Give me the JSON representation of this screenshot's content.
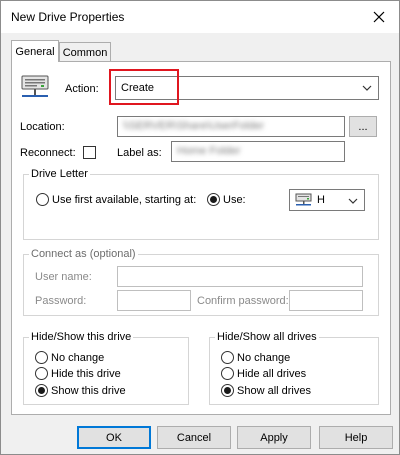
{
  "window": {
    "title": "New Drive Properties"
  },
  "tabs": [
    {
      "label": "General",
      "active": true
    },
    {
      "label": "Common",
      "active": false
    }
  ],
  "action": {
    "label": "Action:",
    "value": "Create",
    "icon": "network-drive-icon"
  },
  "location": {
    "label": "Location:",
    "value": "\\\\SERVER\\Share\\UserFolder",
    "browse_label": "..."
  },
  "reconnect": {
    "label": "Reconnect:",
    "checked": false
  },
  "label_as": {
    "label": "Label as:",
    "value": "Home Folder"
  },
  "drive_letter": {
    "title": "Drive Letter",
    "use_first_label": "Use first available, starting at:",
    "use_label": "Use:",
    "selected": "use",
    "letter": "H",
    "icon": "drive-icon"
  },
  "connect_as": {
    "title": "Connect as (optional)",
    "username_label": "User name:",
    "password_label": "Password:",
    "confirm_label": "Confirm password:"
  },
  "hide_show_this": {
    "title": "Hide/Show this drive",
    "options": [
      "No change",
      "Hide this drive",
      "Show this drive"
    ],
    "selected": 2
  },
  "hide_show_all": {
    "title": "Hide/Show all drives",
    "options": [
      "No change",
      "Hide all drives",
      "Show all drives"
    ],
    "selected": 2
  },
  "buttons": {
    "ok": "OK",
    "cancel": "Cancel",
    "apply": "Apply",
    "help": "Help"
  },
  "colors": {
    "highlight": "#e0161f",
    "focus": "#0078d7"
  }
}
